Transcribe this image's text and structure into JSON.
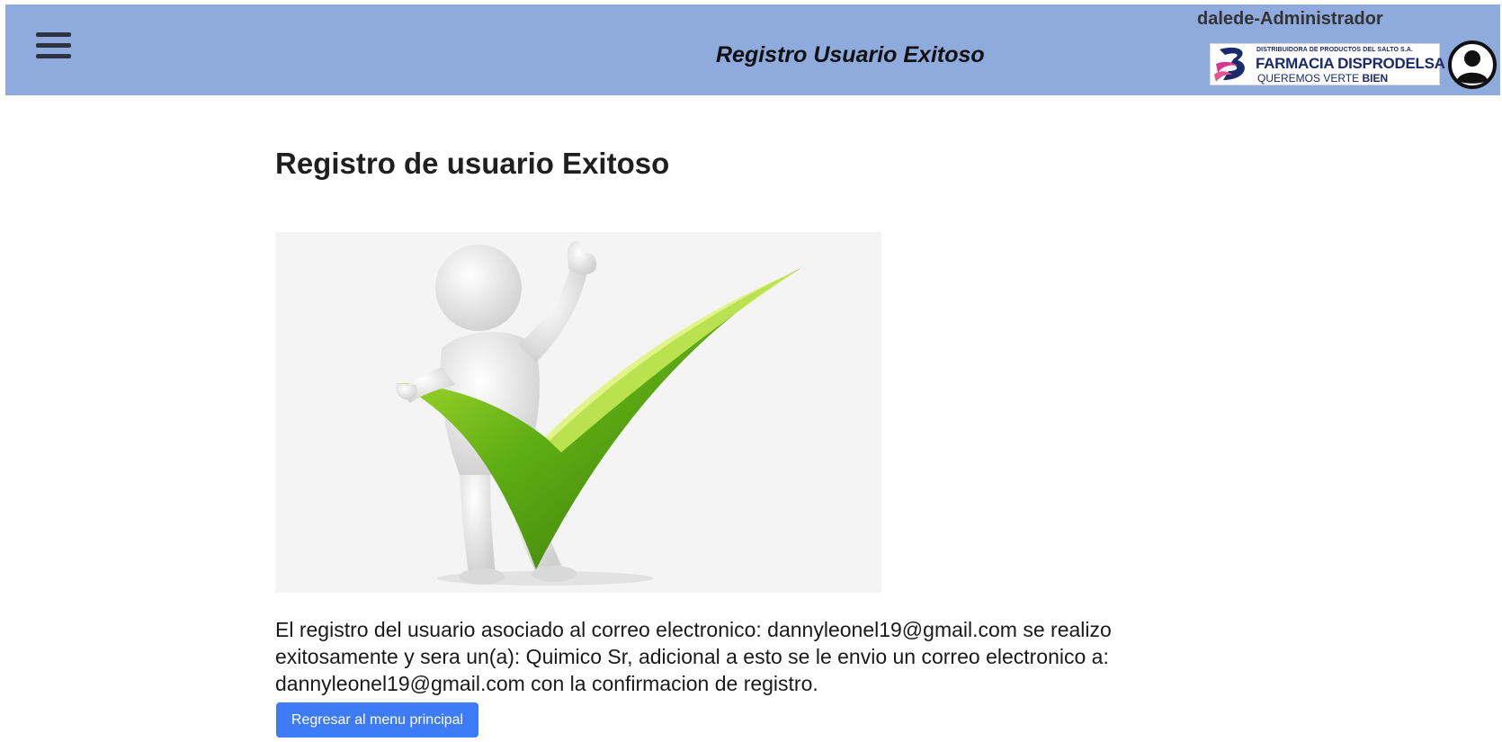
{
  "header": {
    "menu_icon": "hamburger-menu-icon",
    "title": "Registro Usuario Exitoso",
    "username": "dalede-Administrador",
    "logo": {
      "line_small": "DISTRIBUIDORA DE PRODUCTOS DEL SALTO S.A.",
      "line_main": "FARMACIA DISPRODELSA",
      "slogan_prefix": "QUEREMOS VERTE",
      "slogan_bold": "BIEN"
    },
    "avatar_icon": "user-circle-icon",
    "background_color": "#8faadc"
  },
  "main": {
    "heading": "Registro de usuario Exitoso",
    "image": "success-checkmark-illustration",
    "message": "El registro del usuario asociado al correo electronico: dannyleonel19@gmail.com se realizo exitosamente y sera un(a): Quimico Sr, adicional a esto se le envio un correo electronico a: dannyleonel19@gmail.com con la confirmacion de registro.",
    "back_button_label": "Regresar al menu principal",
    "button_color": "#3d7bf7"
  }
}
